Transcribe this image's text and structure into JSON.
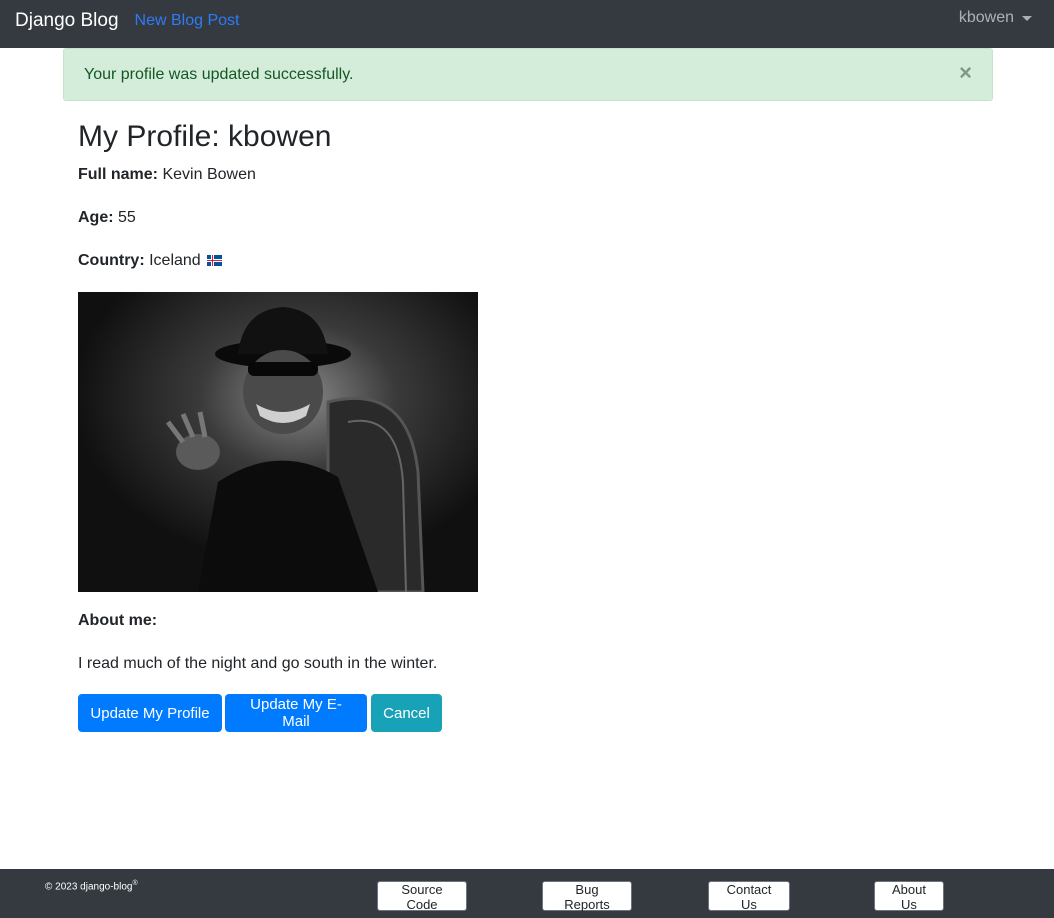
{
  "navbar": {
    "brand": "Django Blog",
    "new_post": "New Blog Post",
    "user": "kbowen"
  },
  "alert": {
    "message": "Your profile was updated successfully.",
    "close": "×"
  },
  "profile": {
    "title": "My Profile: kbowen",
    "full_name_label": "Full name:",
    "full_name": "Kevin Bowen",
    "age_label": "Age:",
    "age": "55",
    "country_label": "Country:",
    "country": "Iceland",
    "about_label": "About me:",
    "about": "I read much of the night and go south in the winter."
  },
  "buttons": {
    "update_profile": "Update My Profile",
    "update_email": "Update My E-Mail",
    "cancel": "Cancel"
  },
  "footer": {
    "copyright": "© 2023 django-blog",
    "registered": "®",
    "links": [
      "Source Code",
      "Bug Reports",
      "Contact Us",
      "About Us"
    ]
  },
  "colors": {
    "navbar": "#343a40",
    "primary": "#007bff",
    "info": "#17a2b8",
    "alert_bg": "#d4edda",
    "alert_text": "#155724"
  }
}
